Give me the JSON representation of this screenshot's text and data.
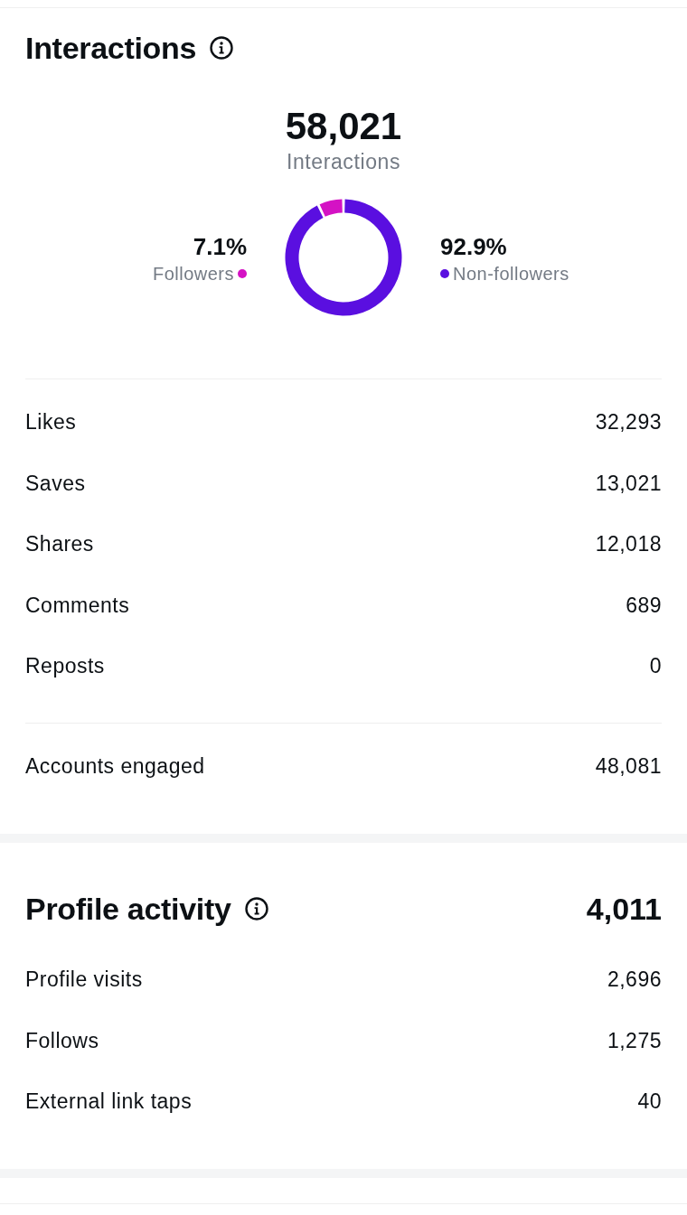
{
  "interactions": {
    "title": "Interactions",
    "total": "58,021",
    "total_label": "Interactions",
    "breakdown": {
      "chart_data": {
        "type": "donut",
        "categories": [
          "Followers",
          "Non-followers"
        ],
        "values": [
          7.1,
          92.9
        ],
        "value_labels": [
          "7.1%",
          "92.9%"
        ]
      },
      "segments": [
        {
          "color": "#d412c4"
        },
        {
          "color": "#5a0fe0"
        }
      ]
    },
    "metrics": [
      {
        "label": "Likes",
        "value": "32,293"
      },
      {
        "label": "Saves",
        "value": "13,021"
      },
      {
        "label": "Shares",
        "value": "12,018"
      },
      {
        "label": "Comments",
        "value": "689"
      },
      {
        "label": "Reposts",
        "value": "0"
      }
    ],
    "summary": [
      {
        "label": "Accounts engaged",
        "value": "48,081"
      }
    ]
  },
  "profile_activity": {
    "title": "Profile activity",
    "total": "4,011",
    "metrics": [
      {
        "label": "Profile visits",
        "value": "2,696"
      },
      {
        "label": "Follows",
        "value": "1,275"
      },
      {
        "label": "External link taps",
        "value": "40"
      }
    ]
  }
}
